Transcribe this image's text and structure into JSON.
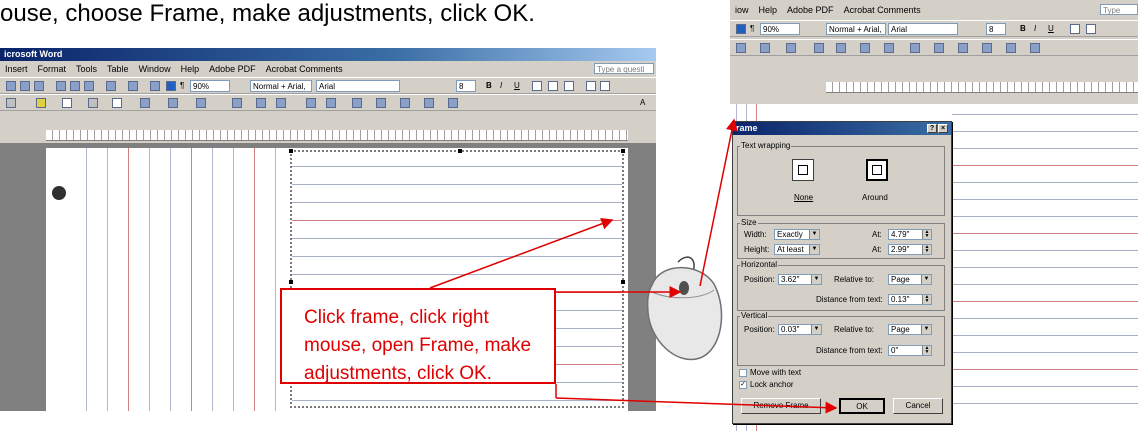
{
  "caption": "ouse, choose Frame, make adjustments, click OK.",
  "callout_text": "Click frame, click right mouse, open Frame, make adjustments, click OK.",
  "colors": {
    "accent_red": "#e00000",
    "title_blue": "#0a246a"
  },
  "left_window": {
    "title": "icrosoft Word",
    "menu": [
      "Insert",
      "Format",
      "Tools",
      "Table",
      "Window",
      "Help",
      "Adobe PDF",
      "Acrobat Comments"
    ],
    "ask_box": "Type a questi",
    "zoom": "90%",
    "style": "Normal + Arial,",
    "font": "Arial",
    "font_size": "8"
  },
  "right_window": {
    "menu": [
      "iow",
      "Help",
      "Adobe PDF",
      "Acrobat Comments"
    ],
    "ask_box": "Type",
    "zoom": "90%",
    "style": "Normal + Arial,",
    "font": "Arial",
    "font_size": "8"
  },
  "dialog": {
    "title": "rame",
    "help_btn": "?",
    "close_btn": "×",
    "text_wrapping_label": "Text wrapping",
    "wrap_none": "None",
    "wrap_around": "Around",
    "size_label": "Size",
    "width_label": "Width:",
    "width_value": "Exactly",
    "width_at_label": "At:",
    "width_at_value": "4.79\"",
    "height_label": "Height:",
    "height_value": "At least",
    "height_at_label": "At:",
    "height_at_value": "2.99\"",
    "horizontal_label": "Horizontal",
    "h_position_label": "Position:",
    "h_position_value": "3.62\"",
    "h_relative_label": "Relative to:",
    "h_relative_value": "Page",
    "h_distance_label": "Distance from text:",
    "h_distance_value": "0.13\"",
    "vertical_label": "Vertical",
    "v_position_label": "Position:",
    "v_position_value": "0.03\"",
    "v_relative_label": "Relative to:",
    "v_relative_value": "Page",
    "v_distance_label": "Distance from text:",
    "v_distance_value": "0\"",
    "move_with_text": "Move with text",
    "lock_anchor": "Lock anchor",
    "remove_frame": "Remove Frame",
    "ok": "OK",
    "cancel": "Cancel"
  }
}
